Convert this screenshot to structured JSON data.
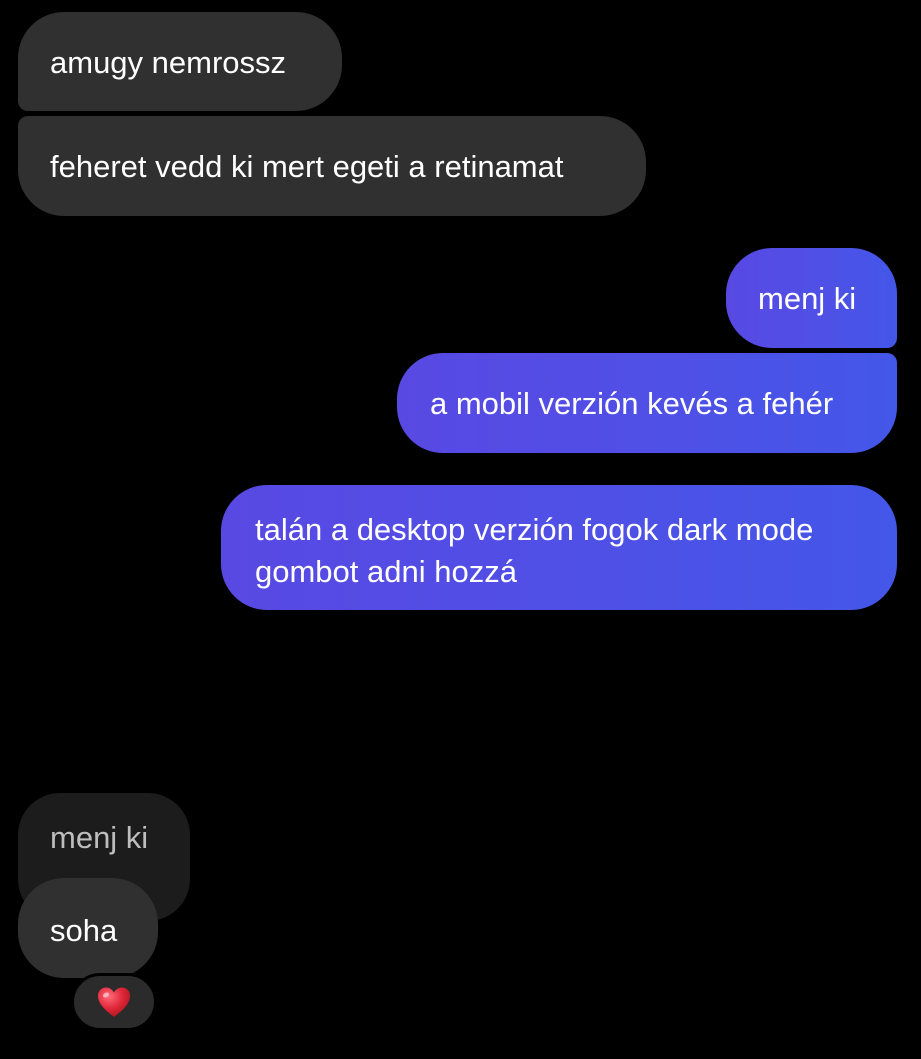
{
  "messages": [
    {
      "direction": "incoming",
      "text": "amugy nemrossz"
    },
    {
      "direction": "incoming",
      "text": "feheret vedd ki mert egeti a retinamat"
    },
    {
      "direction": "outgoing",
      "text": "menj ki"
    },
    {
      "direction": "outgoing",
      "text": "a mobil verzión kevés a fehér"
    },
    {
      "direction": "outgoing",
      "text": "talán a desktop verzión fogok dark mode gombot adni hozzá"
    }
  ],
  "reply": {
    "quoted_text": "menj ki",
    "text": "soha",
    "reaction_icon": "red-heart-icon"
  },
  "colors": {
    "background": "#000000",
    "incoming_bubble": "#303030",
    "outgoing_bubble_start": "#5849e3",
    "outgoing_bubble_end": "#4357e8",
    "quoted_bubble": "#1c1c1c",
    "heart": "#e0283a"
  }
}
